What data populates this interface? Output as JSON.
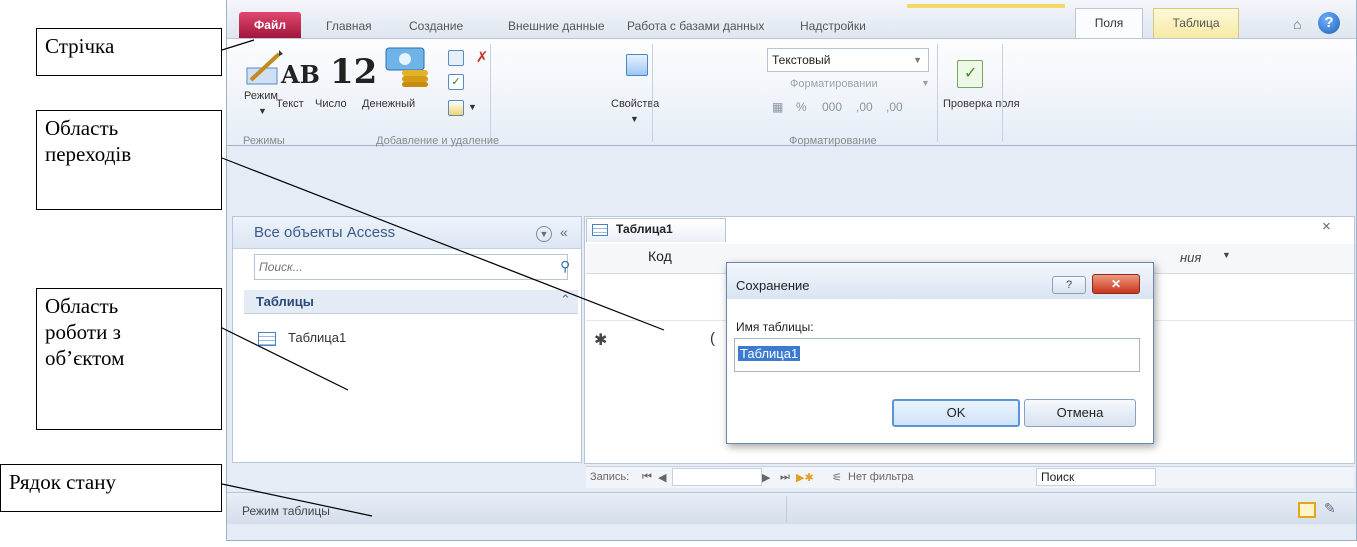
{
  "ribbon_tabs": {
    "file": "Файл",
    "home": "Главная",
    "create": "Создание",
    "external": "Внешние данные",
    "database": "Работа с базами данных",
    "addins": "Надстройки",
    "fields": "Поля",
    "table": "Таблица"
  },
  "ribbon": {
    "mode_button": "Режим",
    "text_button": "Текст",
    "number_button": "Число",
    "currency_button": "Денежный",
    "properties_button": "Свойства",
    "data_type_value": "Текстовый",
    "format_dropdown": "Форматировании",
    "number_formats": [
      "%",
      "000",
      ",00",
      ",00"
    ],
    "validation_button": "Проверка поля",
    "groups": {
      "modes": "Режимы",
      "add_delete": "Добавление и удаление",
      "formatting": "Форматирование"
    },
    "icons": {
      "ab": "AB",
      "twelve": "12"
    }
  },
  "nav_pane": {
    "title": "Все объекты Access",
    "search_placeholder": "Поиск...",
    "group_label": "Таблицы",
    "items": [
      "Таблица1"
    ]
  },
  "document": {
    "tab_label": "Таблица1",
    "column_header": "Код",
    "column_header_2": "ния",
    "new_row_value": "("
  },
  "record_nav": {
    "records_label": "Запись:",
    "no_filter": "Нет фильтра",
    "search_label": "Поиск"
  },
  "statusbar": {
    "text": "Режим таблицы"
  },
  "dialog": {
    "title": "Сохранение",
    "help_glyph": "?",
    "close_glyph": "✕",
    "field_label": "Имя таблицы:",
    "field_value": "Таблица1",
    "ok_label": "OK",
    "cancel_label": "Отмена"
  },
  "callouts": {
    "ribbon": "Стрічка",
    "nav_line1": "Область",
    "nav_line2": "переходів",
    "obj_line1": "Область",
    "obj_line2": "роботи з",
    "obj_line3": "об’єктом",
    "status": "Рядок стану"
  },
  "colors": {
    "file_tab": "#c3204d",
    "table_tab": "#f6eaa5",
    "selection": "#3d7bd0"
  }
}
